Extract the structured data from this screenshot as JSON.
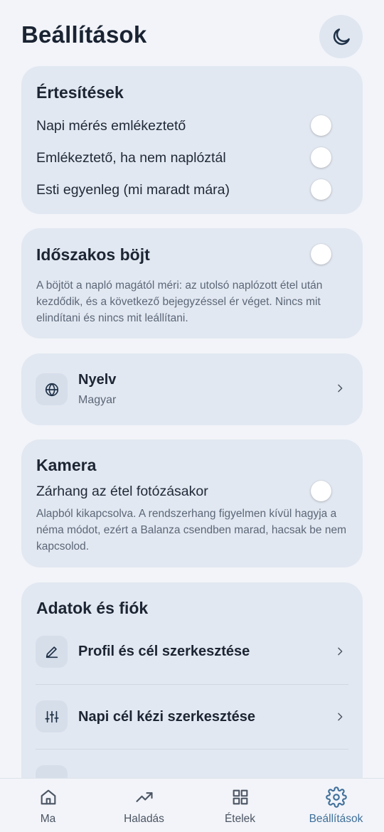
{
  "header": {
    "title": "Beállítások",
    "theme_icon": "moon-icon"
  },
  "notifications": {
    "title": "Értesítések",
    "items": [
      {
        "label": "Napi mérés emlékeztető",
        "on": false
      },
      {
        "label": "Emlékeztető, ha nem naplóztál",
        "on": false
      },
      {
        "label": "Esti egyenleg (mi maradt mára)",
        "on": false
      }
    ]
  },
  "fasting": {
    "title": "Időszakos böjt",
    "on": false,
    "description": "A böjtöt a napló magától méri: az utolsó naplózott étel után kezdődik, és a következő bejegyzéssel ér véget. Nincs mit elindítani és nincs mit leállítani."
  },
  "language": {
    "label": "Nyelv",
    "value": "Magyar",
    "icon": "globe-icon"
  },
  "camera": {
    "title": "Kamera",
    "shutter_label": "Zárhang az étel fotózásakor",
    "on": false,
    "description": "Alapból kikapcsolva. A rendszerhang figyelmen kívül hagyja a néma módot, ezért a Balanza csendben marad, hacsak be nem kapcsolod."
  },
  "data": {
    "title": "Adatok és fiók",
    "items": [
      {
        "label": "Profil és cél szerkesztése",
        "icon": "pencil-icon"
      },
      {
        "label": "Napi cél kézi szerkesztése",
        "icon": "sliders-icon"
      }
    ]
  },
  "tabbar": {
    "tabs": [
      {
        "label": "Ma",
        "icon": "home-icon"
      },
      {
        "label": "Haladás",
        "icon": "trend-up-icon"
      },
      {
        "label": "Ételek",
        "icon": "grid-icon"
      },
      {
        "label": "Beállítások",
        "icon": "gear-icon",
        "active": true
      }
    ]
  },
  "colors": {
    "accent": "#3f6f9a",
    "card": "#e2e8f1",
    "background": "#f2f4f9"
  }
}
